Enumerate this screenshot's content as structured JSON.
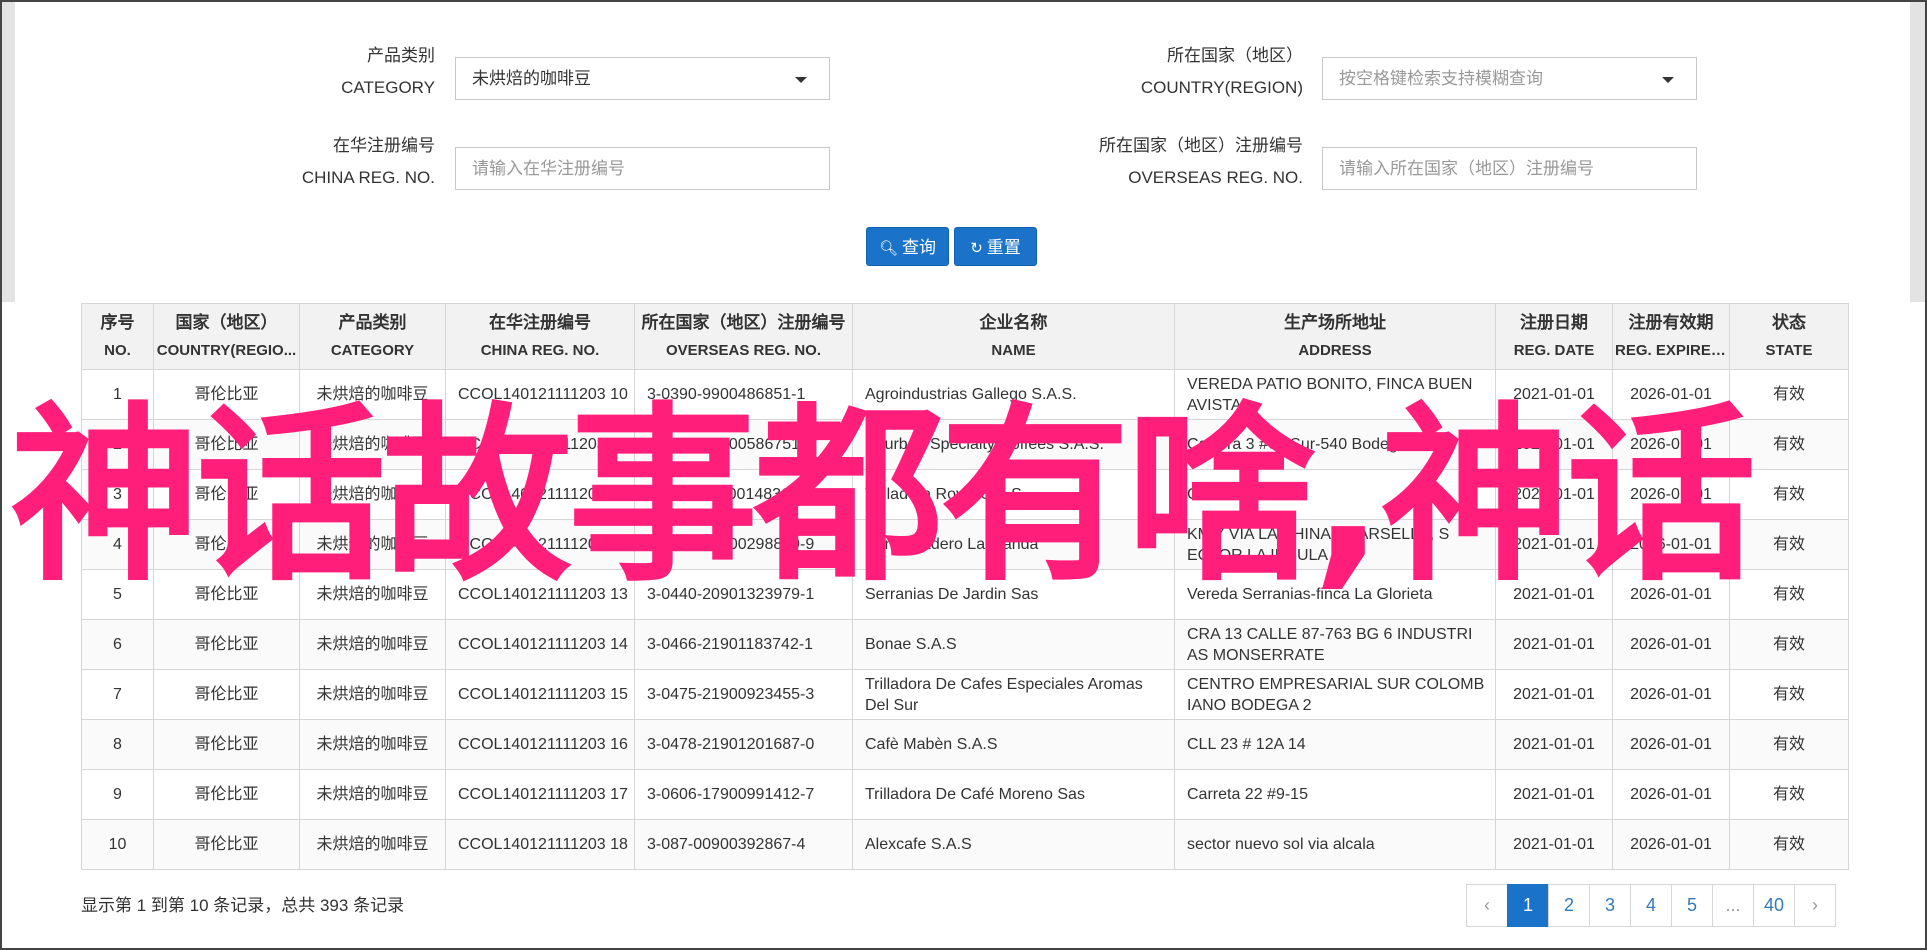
{
  "form": {
    "category": {
      "label_zh": "产品类别",
      "label_en": "CATEGORY",
      "value": "未烘焙的咖啡豆"
    },
    "country": {
      "label_zh": "所在国家（地区）",
      "label_en": "COUNTRY(REGION)",
      "placeholder": "按空格键检索支持模糊查询"
    },
    "china_reg": {
      "label_zh": "在华注册编号",
      "label_en": "CHINA REG. NO.",
      "placeholder": "请输入在华注册编号"
    },
    "overseas_reg": {
      "label_zh": "所在国家（地区）注册编号",
      "label_en": "OVERSEAS REG. NO.",
      "placeholder": "请输入所在国家（地区）注册编号"
    },
    "query_label": "查询",
    "reset_label": "重置"
  },
  "table": {
    "headers": [
      {
        "zh": "序号",
        "en": "NO."
      },
      {
        "zh": "国家（地区）",
        "en": "COUNTRY(REGIO..."
      },
      {
        "zh": "产品类别",
        "en": "CATEGORY"
      },
      {
        "zh": "在华注册编号",
        "en": "CHINA REG. NO."
      },
      {
        "zh": "所在国家（地区）注册编号",
        "en": "OVERSEAS REG. NO."
      },
      {
        "zh": "企业名称",
        "en": "NAME"
      },
      {
        "zh": "生产场所地址",
        "en": "ADDRESS"
      },
      {
        "zh": "注册日期",
        "en": "REG. DATE"
      },
      {
        "zh": "注册有效期",
        "en": "REG. EXPIRE ..."
      },
      {
        "zh": "状态",
        "en": "STATE"
      }
    ],
    "rows": [
      [
        "1",
        "哥伦比亚",
        "未烘焙的咖啡豆",
        "CCOL140121111203 10",
        "3-0390-9900486851-1",
        "Agroindustrias Gallego S.A.S.",
        "VEREDA PATIO BONITO, FINCA BUEN AVISTA",
        "2021-01-01",
        "2026-01-01",
        "有效"
      ],
      [
        "2",
        "哥伦比亚",
        "未烘焙的咖啡豆",
        "CCOL140121111203 11",
        "3-0392-19900586751-1",
        "Bourbon Specialty Coffees S.A.S.",
        "Carrera 3 #61 Sur-540 Bodega 3 5",
        "2021-01-01",
        "2026-01-01",
        "有效"
      ],
      [
        "3",
        "哥伦比亚",
        "未烘焙的咖啡豆",
        "CCOL140121111202 12",
        "3-0411-20000148313-1",
        "Trilladora Royal S.A.S.",
        "Calle 2 # 2-30",
        "2021-01-01",
        "2026-01-01",
        "有效"
      ],
      [
        "4",
        "哥伦比亚",
        "未烘焙的咖啡豆",
        "CCOL140121111203 12",
        "3-0430-20000298869-9",
        "Beneficiadero La Irlanda",
        "KM 7 VIA LA CHINA - MARSELLA, S ECTOR LA INSULA",
        "2021-01-01",
        "2026-01-01",
        "有效"
      ],
      [
        "5",
        "哥伦比亚",
        "未烘焙的咖啡豆",
        "CCOL140121111203 13",
        "3-0440-20901323979-1",
        "Serranias De Jardin Sas",
        "Vereda Serranias-finca La Glorieta",
        "2021-01-01",
        "2026-01-01",
        "有效"
      ],
      [
        "6",
        "哥伦比亚",
        "未烘焙的咖啡豆",
        "CCOL140121111203 14",
        "3-0466-21901183742-1",
        "Bonae S.A.S",
        "CRA 13 CALLE 87-763 BG 6 INDUSTRI AS MONSERRATE",
        "2021-01-01",
        "2026-01-01",
        "有效"
      ],
      [
        "7",
        "哥伦比亚",
        "未烘焙的咖啡豆",
        "CCOL140121111203 15",
        "3-0475-21900923455-3",
        "Trilladora De Cafes Especiales Aromas Del Sur",
        "CENTRO EMPRESARIAL SUR COLOMB IANO BODEGA 2",
        "2021-01-01",
        "2026-01-01",
        "有效"
      ],
      [
        "8",
        "哥伦比亚",
        "未烘焙的咖啡豆",
        "CCOL140121111203 16",
        "3-0478-21901201687-0",
        "Cafè Mabèn S.A.S",
        "CLL 23 # 12A 14",
        "2021-01-01",
        "2026-01-01",
        "有效"
      ],
      [
        "9",
        "哥伦比亚",
        "未烘焙的咖啡豆",
        "CCOL140121111203 17",
        "3-0606-17900991412-7",
        "Trilladora De Café Moreno Sas",
        "Carreta 22 #9-15",
        "2021-01-01",
        "2026-01-01",
        "有效"
      ],
      [
        "10",
        "哥伦比亚",
        "未烘焙的咖啡豆",
        "CCOL140121111203 18",
        "3-087-00900392867-4",
        "Alexcafe S.A.S",
        "sector nuevo sol via alcala",
        "2021-01-01",
        "2026-01-01",
        "有效"
      ]
    ]
  },
  "footer": {
    "summary": "显示第 1 到第 10 条记录，总共 393 条记录",
    "pages": [
      "‹",
      "1",
      "2",
      "3",
      "4",
      "5",
      "...",
      "40",
      "›"
    ],
    "active_page": "1"
  },
  "overlay_text": "神话故事都有啥,神话",
  "colors": {
    "accent": "#1a73c8",
    "overlay": "#ff1f7a"
  }
}
